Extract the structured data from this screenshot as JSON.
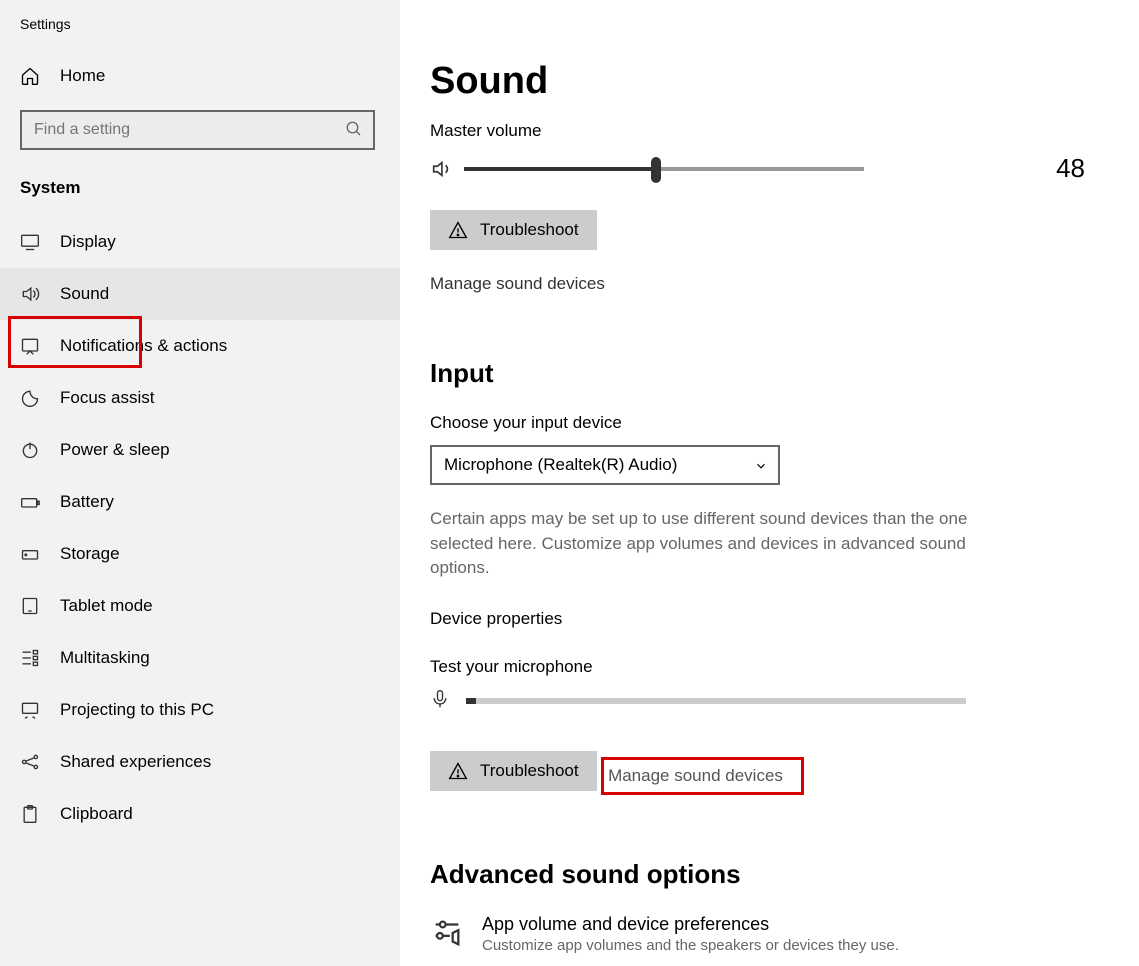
{
  "app_title": "Settings",
  "home_label": "Home",
  "search_placeholder": "Find a setting",
  "category": "System",
  "sidebar": {
    "items": [
      {
        "label": "Display"
      },
      {
        "label": "Sound"
      },
      {
        "label": "Notifications & actions"
      },
      {
        "label": "Focus assist"
      },
      {
        "label": "Power & sleep"
      },
      {
        "label": "Battery"
      },
      {
        "label": "Storage"
      },
      {
        "label": "Tablet mode"
      },
      {
        "label": "Multitasking"
      },
      {
        "label": "Projecting to this PC"
      },
      {
        "label": "Shared experiences"
      },
      {
        "label": "Clipboard"
      }
    ]
  },
  "main": {
    "title": "Sound",
    "master_volume_label": "Master volume",
    "volume_value": "48",
    "troubleshoot_label": "Troubleshoot",
    "manage_sound_devices": "Manage sound devices",
    "input_title": "Input",
    "choose_input_label": "Choose your input device",
    "input_device": "Microphone (Realtek(R) Audio)",
    "input_help": "Certain apps may be set up to use different sound devices than the one selected here. Customize app volumes and devices in advanced sound options.",
    "device_properties": "Device properties",
    "test_mic_label": "Test your microphone",
    "troubleshoot_label2": "Troubleshoot",
    "manage_sound_devices2": "Manage sound devices",
    "advanced_title": "Advanced sound options",
    "app_volume_title": "App volume and device preferences",
    "app_volume_desc": "Customize app volumes and the speakers or devices they use."
  }
}
